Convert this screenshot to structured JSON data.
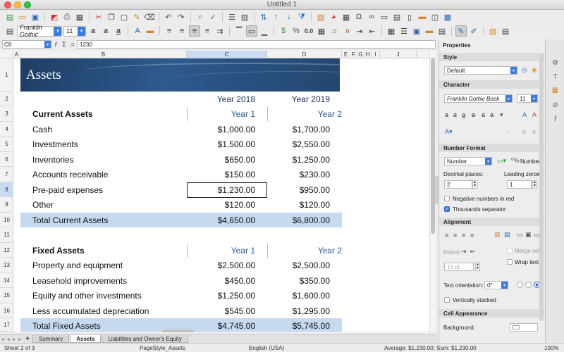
{
  "window": {
    "title": "Untitled 1"
  },
  "toolbar": {
    "font_name": "Franklin Gothic",
    "font_size": "11"
  },
  "formula_bar": {
    "cell_ref": "C8",
    "sum_symbol": "Σ",
    "equals_symbol": "=",
    "content": "1230"
  },
  "columns": [
    "A",
    "B",
    "C",
    "D",
    "E",
    "F",
    "G",
    "H",
    "I",
    "J"
  ],
  "rows": [
    "1",
    "2",
    "3",
    "4",
    "5",
    "6",
    "7",
    "8",
    "9",
    "10",
    "11",
    "12",
    "13",
    "14",
    "15",
    "16",
    "17"
  ],
  "sheet": {
    "banner_title": "Assets",
    "year_2018": "Year 2018",
    "year_2019": "Year 2019",
    "current": {
      "heading": "Current Assets",
      "col1": "Year 1",
      "col2": "Year 2",
      "items": [
        {
          "label": "Cash",
          "y1": "$1,000.00",
          "y2": "$1,700.00"
        },
        {
          "label": "Investments",
          "y1": "$1,500.00",
          "y2": "$2,550.00"
        },
        {
          "label": "Inventories",
          "y1": "$650.00",
          "y2": "$1,250.00"
        },
        {
          "label": "Accounts receivable",
          "y1": "$150.00",
          "y2": "$230.00"
        },
        {
          "label": "Pre-paid expenses",
          "y1": "$1,230.00",
          "y2": "$950.00"
        },
        {
          "label": "Other",
          "y1": "$120.00",
          "y2": "$120.00"
        }
      ],
      "total": {
        "label": "Total Current Assets",
        "y1": "$4,650.00",
        "y2": "$6,800.00"
      }
    },
    "fixed": {
      "heading": "Fixed Assets",
      "col1": "Year 1",
      "col2": "Year 2",
      "items": [
        {
          "label": "Property and equipment",
          "y1": "$2,500.00",
          "y2": "$2,500.00"
        },
        {
          "label": "Leasehold improvements",
          "y1": "$450.00",
          "y2": "$350.00"
        },
        {
          "label": "Equity and other investments",
          "y1": "$1,250.00",
          "y2": "$1,600.00"
        },
        {
          "label": "Less accumulated depreciation",
          "y1": "$545.00",
          "y2": "$1,295.00"
        }
      ],
      "total": {
        "label": "Total Fixed Assets",
        "y1": "$4,745.00",
        "y2": "$5,745.00"
      }
    }
  },
  "tabs": {
    "add": "+",
    "items": [
      "Summary",
      "Assets",
      "Liabilities and Owner's Equity"
    ],
    "active": "Assets"
  },
  "status": {
    "sheet": "Sheet 2 of 3",
    "page_style": "PageStyle_Assets",
    "language": "English (USA)",
    "selection": "Average: $1,230.00; Sum: $1,230.00",
    "zoom": "100%"
  },
  "sidebar": {
    "title": "Properties",
    "style": {
      "heading": "Style",
      "value": "Default"
    },
    "character": {
      "heading": "Character",
      "font": "Franklin Gothic Book",
      "size": "11"
    },
    "number_format": {
      "heading": "Number Format",
      "category": "Number",
      "category_label": "Number",
      "decimal_label": "Decimal places:",
      "leading_label": "Leading zeroes:",
      "decimal_value": "2",
      "leading_value": "1",
      "negative_red": "Negative numbers in red",
      "thousands": "Thousands separator"
    },
    "alignment": {
      "heading": "Alignment",
      "indent_label": "Indent:",
      "indent_value": "16 pt",
      "merge_cells": "Merge cells",
      "wrap_text": "Wrap text",
      "orientation_label": "Text orientation:",
      "orientation_value": "0°",
      "vertical_stacked": "Vertically stacked"
    },
    "cell_appearance": {
      "heading": "Cell Appearance",
      "background_label": "Background:"
    }
  }
}
